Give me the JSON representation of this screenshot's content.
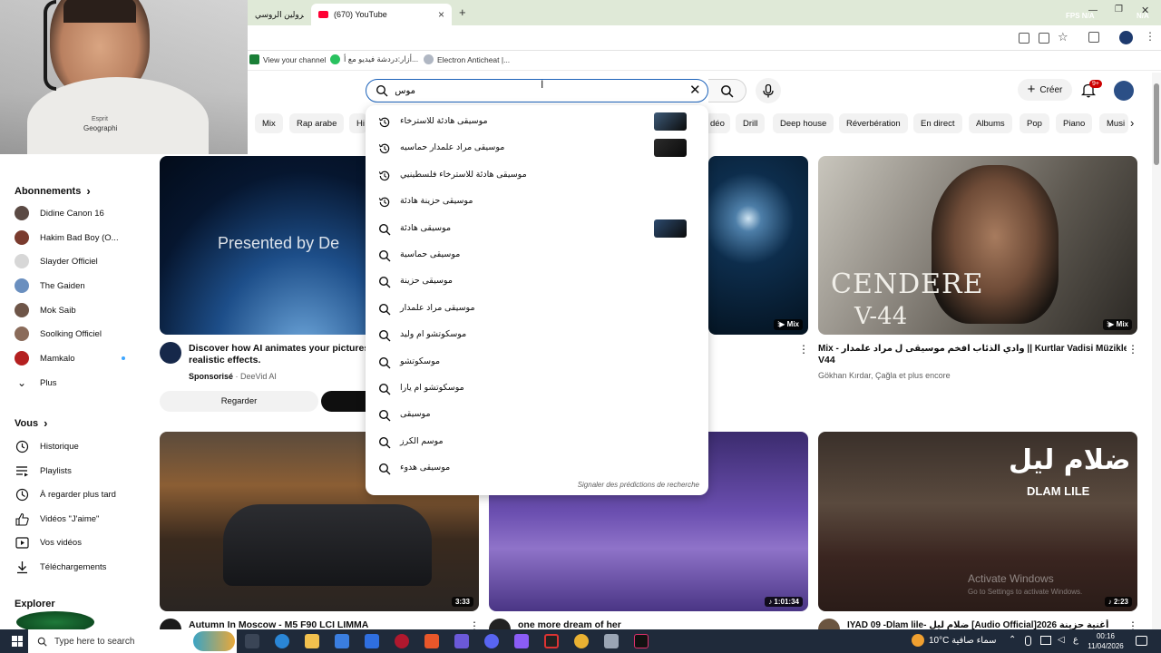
{
  "browser": {
    "tabs": [
      {
        "title": "الرولين الروسي",
        "active": false
      },
      {
        "title": "(670) YouTube",
        "active": true
      }
    ],
    "new_tab": "+",
    "overlay_right": "FPS N/A",
    "overlay_right2": "N/A",
    "bookmarks": [
      {
        "label": "View your channel",
        "color": "#1a7f37"
      },
      {
        "label": "أزار:دردشة فيديو مع أ...",
        "color": "#29c25f"
      },
      {
        "label": "Electron Anticheat |...",
        "color": "#b0b7c3"
      }
    ]
  },
  "header": {
    "search_value": "موس",
    "create_label": "Créer",
    "notif_count": "9+"
  },
  "chips": [
    "Mix",
    "Rap arabe",
    "Hi",
    "déo",
    "Drill",
    "Deep house",
    "Réverbération",
    "En direct",
    "Albums",
    "Pop",
    "Piano",
    "Musi"
  ],
  "sidebar": {
    "subs_title": "Abonnements",
    "subs": [
      {
        "label": "Didine Canon 16",
        "color": "#5b4a44"
      },
      {
        "label": "Hakim Bad Boy (O...",
        "color": "#7a3b2e"
      },
      {
        "label": "Slayder Officiel",
        "color": "#d7d7d7"
      },
      {
        "label": "The Gaiden",
        "color": "#6a8fbf"
      },
      {
        "label": "Mok Saib",
        "color": "#6e5548"
      },
      {
        "label": "Soolking Officiel",
        "color": "#8a6b5a"
      },
      {
        "label": "Mamkalo",
        "color": "#b42020"
      },
      {
        "label": "Plus",
        "color": ""
      }
    ],
    "you_title": "Vous",
    "you": [
      {
        "label": "Historique",
        "icon": "history-icon"
      },
      {
        "label": "Playlists",
        "icon": "playlist-icon"
      },
      {
        "label": "À regarder plus tard",
        "icon": "clock-icon"
      },
      {
        "label": "Vidéos \"J'aime\"",
        "icon": "thumb-up-icon"
      },
      {
        "label": "Vos vidéos",
        "icon": "play-square-icon"
      },
      {
        "label": "Téléchargements",
        "icon": "download-icon"
      }
    ],
    "explore_title": "Explorer"
  },
  "videos": {
    "ad": {
      "title_line1": "Discover how AI animates your pictures v",
      "title_line2": "realistic effects.",
      "sponsor": "Sponsorisé",
      "channel": "· DeeVid AI",
      "overlay": "Presented by De",
      "cta": "Regarder"
    },
    "v2": {
      "badge": "Mix"
    },
    "v3": {
      "title_line1": "Mix - وادي الذئاب افخم موسيقى ل مراد علمدار || Kurtlar Vadisi Müzikleri - Cendere",
      "title_line2": "V44",
      "channel": "Gökhan Kırdar, Çağla et plus encore",
      "overlay1": "CENDERE",
      "overlay2": "V-44",
      "badge": "Mix"
    },
    "v4": {
      "title": "Autumn In Moscow - M5 F90 LCI LIMMA",
      "duration": "3:33"
    },
    "v5": {
      "title": "one more dream of her",
      "duration": "1:01:34"
    },
    "v6": {
      "title": "IYAD 09 -Dlam lile- ضلام ليل [Audio Official]2026 أغنية حزينة",
      "duration": "2:23",
      "overlay1": "ضلام ليل",
      "overlay2": "DLAM LILE",
      "watermark1": "Activate Windows",
      "watermark2": "Go to Settings to activate Windows."
    }
  },
  "suggestions": {
    "items": [
      {
        "text": "موسيقى هادئة للاسترخاء",
        "icon": "history",
        "thumb": "#3d5a78"
      },
      {
        "text": "موسيقى مراد علمدار حماسيه",
        "icon": "history",
        "thumb": "#2b2b2b"
      },
      {
        "text": "موسيقى هادئة للاسترخاء فلسطينيي",
        "icon": "history",
        "thumb": ""
      },
      {
        "text": "موسيقى حزينة هادئة",
        "icon": "history",
        "thumb": ""
      },
      {
        "text": "موسيقى هادئة",
        "icon": "search",
        "thumb": "#2c4a6e"
      },
      {
        "text": "موسيقى حماسية",
        "icon": "search",
        "thumb": ""
      },
      {
        "text": "موسيقى حزينة",
        "icon": "search",
        "thumb": ""
      },
      {
        "text": "موسيقى مراد علمدار",
        "icon": "search",
        "thumb": ""
      },
      {
        "text": "موسكوتشو ام وليد",
        "icon": "search",
        "thumb": ""
      },
      {
        "text": "موسكوتشو",
        "icon": "search",
        "thumb": ""
      },
      {
        "text": "موسكوتشو ام يارا",
        "icon": "search",
        "thumb": ""
      },
      {
        "text": "موسيقى",
        "icon": "search",
        "thumb": ""
      },
      {
        "text": "موسم الكرز",
        "icon": "search",
        "thumb": ""
      },
      {
        "text": "موسيقى هدوء",
        "icon": "search",
        "thumb": ""
      }
    ],
    "report": "Signaler des prédictions de recherche"
  },
  "taskbar": {
    "search_placeholder": "Type here to search",
    "weather": "10°C  سماء صافية",
    "lang": "ع",
    "time": "00:16",
    "date": "11/04/2026"
  },
  "webcam": {
    "shirt_text1": "Esprit",
    "shirt_text2": "Geographi"
  }
}
